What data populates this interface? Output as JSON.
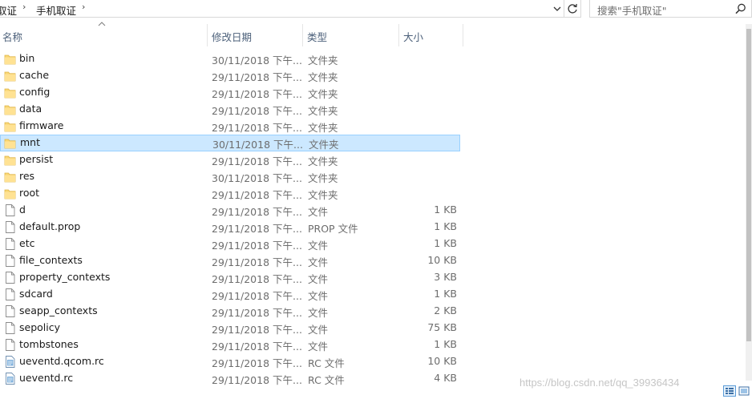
{
  "address_bar": {
    "breadcrumbs": [
      "取证",
      "手机取证"
    ],
    "search_placeholder": "搜索\"手机取证\""
  },
  "columns": {
    "name": "名称",
    "date": "修改日期",
    "type": "类型",
    "size": "大小"
  },
  "files": [
    {
      "name": "bin",
      "date": "30/11/2018 下午...",
      "type": "文件夹",
      "size": "",
      "icon": "folder-icon"
    },
    {
      "name": "cache",
      "date": "29/11/2018 下午...",
      "type": "文件夹",
      "size": "",
      "icon": "folder-icon"
    },
    {
      "name": "config",
      "date": "29/11/2018 下午...",
      "type": "文件夹",
      "size": "",
      "icon": "folder-icon"
    },
    {
      "name": "data",
      "date": "29/11/2018 下午...",
      "type": "文件夹",
      "size": "",
      "icon": "folder-icon"
    },
    {
      "name": "firmware",
      "date": "29/11/2018 下午...",
      "type": "文件夹",
      "size": "",
      "icon": "folder-icon"
    },
    {
      "name": "mnt",
      "date": "30/11/2018 下午...",
      "type": "文件夹",
      "size": "",
      "icon": "folder-icon",
      "selected": true
    },
    {
      "name": "persist",
      "date": "29/11/2018 下午...",
      "type": "文件夹",
      "size": "",
      "icon": "folder-icon"
    },
    {
      "name": "res",
      "date": "30/11/2018 下午...",
      "type": "文件夹",
      "size": "",
      "icon": "folder-icon"
    },
    {
      "name": "root",
      "date": "29/11/2018 下午...",
      "type": "文件夹",
      "size": "",
      "icon": "folder-icon"
    },
    {
      "name": "d",
      "date": "29/11/2018 下午...",
      "type": "文件",
      "size": "1 KB",
      "icon": "file-icon"
    },
    {
      "name": "default.prop",
      "date": "29/11/2018 下午...",
      "type": "PROP 文件",
      "size": "1 KB",
      "icon": "file-icon"
    },
    {
      "name": "etc",
      "date": "29/11/2018 下午...",
      "type": "文件",
      "size": "1 KB",
      "icon": "file-icon"
    },
    {
      "name": "file_contexts",
      "date": "29/11/2018 下午...",
      "type": "文件",
      "size": "10 KB",
      "icon": "file-icon"
    },
    {
      "name": "property_contexts",
      "date": "29/11/2018 下午...",
      "type": "文件",
      "size": "3 KB",
      "icon": "file-icon"
    },
    {
      "name": "sdcard",
      "date": "29/11/2018 下午...",
      "type": "文件",
      "size": "1 KB",
      "icon": "file-icon"
    },
    {
      "name": "seapp_contexts",
      "date": "29/11/2018 下午...",
      "type": "文件",
      "size": "2 KB",
      "icon": "file-icon"
    },
    {
      "name": "sepolicy",
      "date": "29/11/2018 下午...",
      "type": "文件",
      "size": "75 KB",
      "icon": "file-icon"
    },
    {
      "name": "tombstones",
      "date": "29/11/2018 下午...",
      "type": "文件",
      "size": "1 KB",
      "icon": "file-icon"
    },
    {
      "name": "ueventd.qcom.rc",
      "date": "29/11/2018 下午...",
      "type": "RC 文件",
      "size": "10 KB",
      "icon": "rc-file-icon"
    },
    {
      "name": "ueventd.rc",
      "date": "29/11/2018 下午...",
      "type": "RC 文件",
      "size": "4 KB",
      "icon": "rc-file-icon"
    }
  ],
  "watermark": "https://blog.csdn.net/qq_39936434",
  "colors": {
    "selection_bg": "#cce8ff",
    "selection_border": "#99d1ff",
    "folder": "#f8d775",
    "header_text": "#4c607a"
  }
}
